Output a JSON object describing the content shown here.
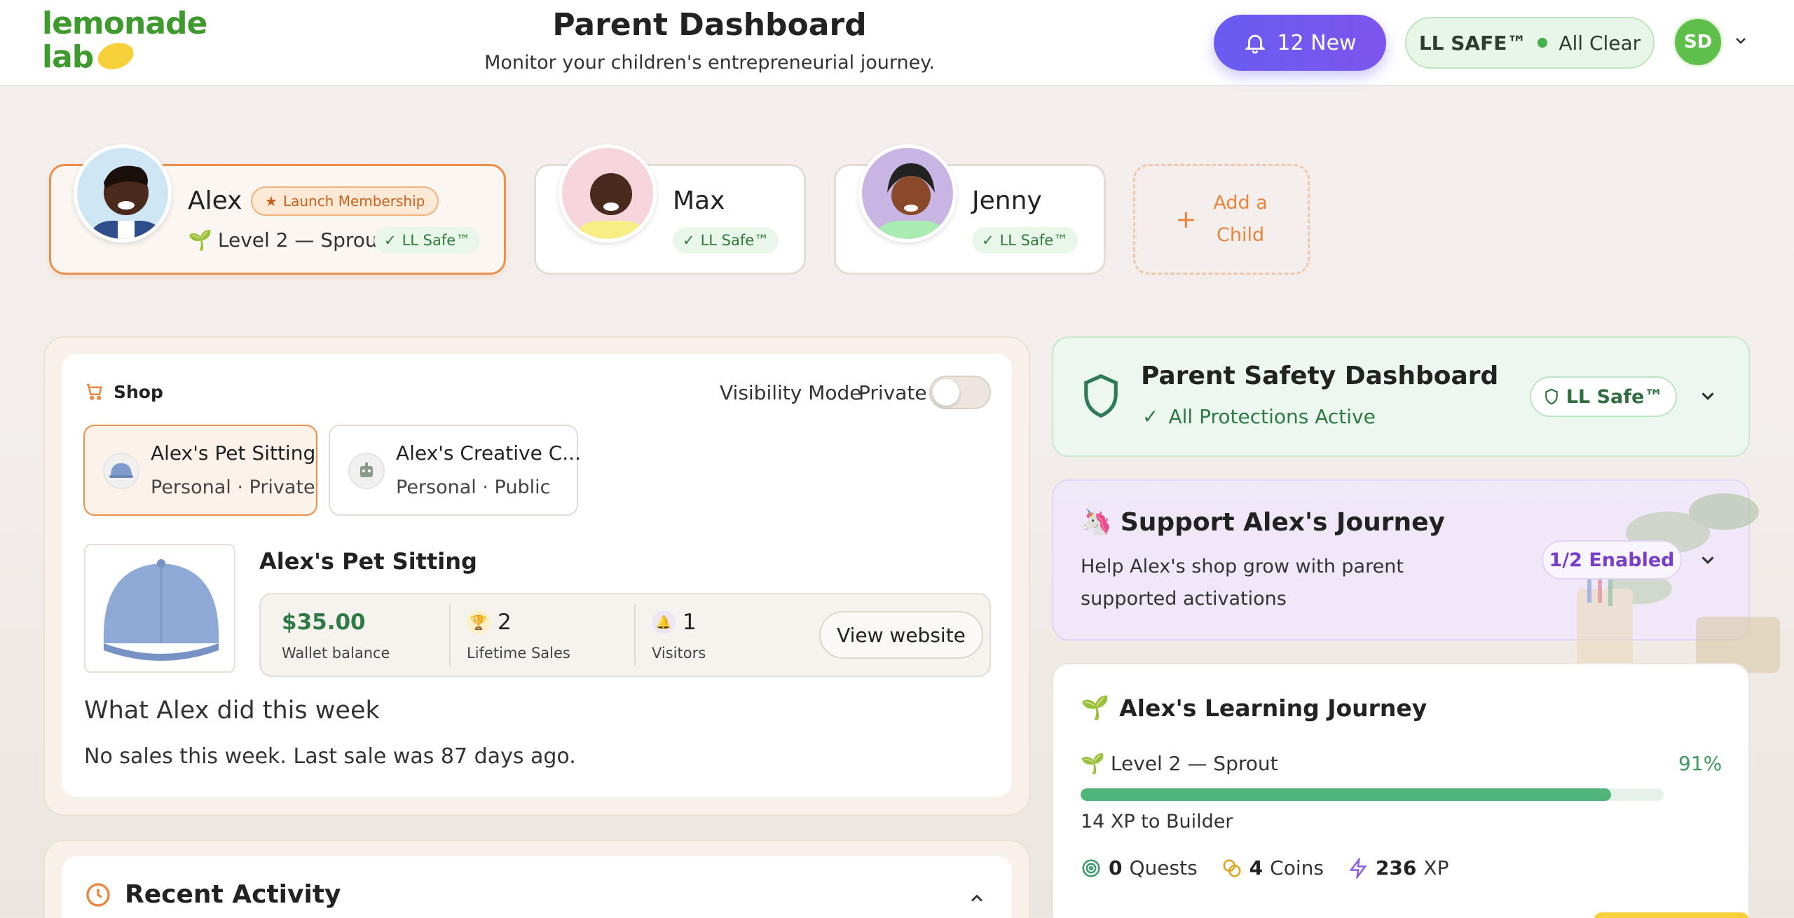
{
  "brand": {
    "line1": "lemonade",
    "line2": "lab"
  },
  "header": {
    "title": "Parent Dashboard",
    "subtitle": "Monitor your children's entrepreneurial journey.",
    "notifications_label": "12 New",
    "safe_label": "LL SAFE™",
    "safe_status": "All Clear",
    "user_initials": "SD"
  },
  "children": [
    {
      "name": "Alex",
      "membership": "Launch Membership",
      "level": "Level 2 — Sprout",
      "safe": "LL Safe™",
      "active": true
    },
    {
      "name": "Max",
      "safe": "LL Safe™",
      "active": false
    },
    {
      "name": "Jenny",
      "safe": "LL Safe™",
      "active": false
    }
  ],
  "add_child": {
    "line1": "Add a",
    "line2": "Child"
  },
  "shop": {
    "label": "Shop",
    "visibility_label": "Visibility Mode",
    "visibility_value": "Private",
    "tabs": [
      {
        "name": "Alex's Pet Sitting",
        "meta": "Personal · Private"
      },
      {
        "name": "Alex's Creative C...",
        "meta": "Personal · Public"
      }
    ],
    "product_title": "Alex's Pet Sitting",
    "wallet_value": "$35.00",
    "wallet_label": "Wallet balance",
    "sales_value": "2",
    "sales_label": "Lifetime Sales",
    "visitors_value": "1",
    "visitors_label": "Visitors",
    "view_button": "View website",
    "week_title": "What Alex did this week",
    "week_text": "No sales this week. Last sale was 87 days ago."
  },
  "recent": {
    "title": "Recent Activity"
  },
  "safety": {
    "title": "Parent Safety Dashboard",
    "status": "All Protections Active",
    "pill": "LL Safe™"
  },
  "support": {
    "title": "Support Alex's Journey",
    "text": "Help Alex's shop grow with parent supported activations",
    "pill": "1/2 Enabled"
  },
  "learning": {
    "title": "Alex's Learning Journey",
    "level": "Level 2 — Sprout",
    "percent_label": "91%",
    "progress": 0.91,
    "xp_text": "14 XP to Builder",
    "quests_value": "0",
    "quests_label": "Quests",
    "coins_value": "4",
    "coins_label": "Coins",
    "xp_value": "236",
    "xp_label": "XP"
  },
  "colors": {
    "brand_green": "#3e9a2c",
    "accent_orange": "#ec8f4a",
    "notif_purple": "#6a5cf0",
    "progress_green": "#4fb57a"
  }
}
